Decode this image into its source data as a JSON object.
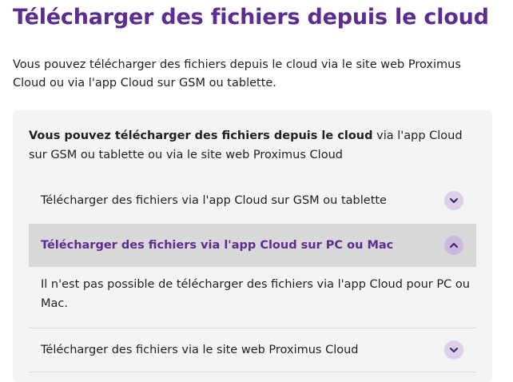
{
  "page": {
    "title": "Télécharger des fichiers depuis le cloud",
    "intro": "Vous pouvez télécharger des fichiers depuis le cloud via le site web Proximus Cloud ou via l'app Cloud sur GSM ou tablette."
  },
  "card": {
    "lead_bold": "Vous pouvez télécharger des fichiers depuis le cloud",
    "lead_rest": " via l'app Cloud sur GSM ou tablette ou via le site web Proximus Cloud",
    "accordion": [
      {
        "label": "Télécharger des fichiers via l'app Cloud sur GSM ou tablette",
        "expanded": false,
        "icon": "chevron-down-icon"
      },
      {
        "label": "Télécharger des fichiers via l'app Cloud sur PC ou Mac",
        "expanded": true,
        "icon": "chevron-up-icon",
        "body": "Il n'est pas possible de télécharger des fichiers via l'app Cloud pour PC ou Mac."
      },
      {
        "label": "Télécharger des fichiers via le site web Proximus Cloud",
        "expanded": false,
        "icon": "chevron-down-icon"
      }
    ]
  },
  "colors": {
    "brand": "#5c2d91",
    "chevron_bg": "#dcd0ea",
    "open_row_bg": "#d9d9d9",
    "card_bg": "#f4f4f4"
  }
}
